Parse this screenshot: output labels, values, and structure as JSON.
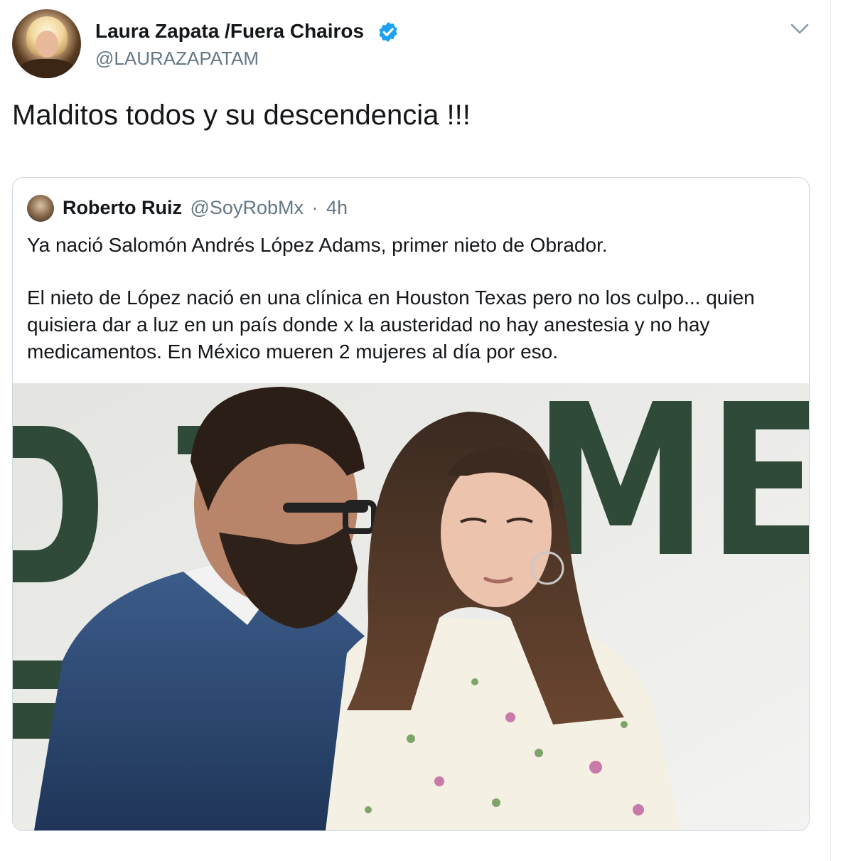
{
  "tweet": {
    "author": {
      "display_name": "Laura Zapata /Fuera Chairos",
      "handle": "@LAURAZAPATAM",
      "verified": true
    },
    "text": "Malditos todos y su descendencia !!!"
  },
  "quoted_tweet": {
    "author": {
      "display_name": "Roberto Ruiz",
      "handle": "@SoyRobMx"
    },
    "separator": "·",
    "time": "4h",
    "paragraphs": [
      "Ya nació Salomón Andrés López Adams, primer nieto de Obrador.",
      "El nieto de López nació en una clínica en Houston Texas pero no los culpo... quien quisiera dar a luz en un país donde x la austeridad no hay anestesia y no hay medicamentos. En México mueren 2 mujeres al día por eso."
    ]
  },
  "colors": {
    "text_primary": "#14171a",
    "text_secondary": "#657786",
    "verified_blue": "#1da1f2",
    "border": "#ccd6dd",
    "backdrop_green": "#2f4a38"
  },
  "icons": {
    "verified": "verified-badge-icon",
    "menu": "chevron-down-icon"
  }
}
